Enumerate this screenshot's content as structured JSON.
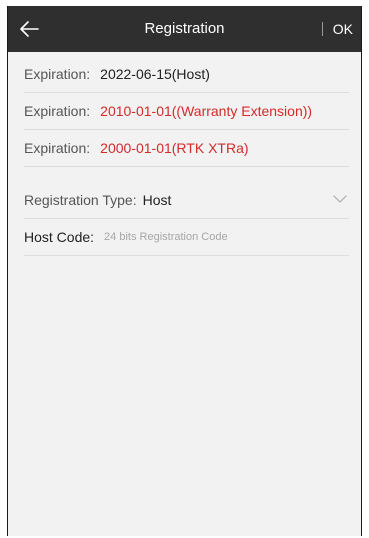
{
  "header": {
    "title": "Registration",
    "ok_label": "OK"
  },
  "expirations": [
    {
      "label": "Expiration:",
      "value": "2022-06-15(Host)",
      "color": "#222222"
    },
    {
      "label": "Expiration:",
      "value": "2010-01-01((Warranty Extension))",
      "color": "#d42a2a"
    },
    {
      "label": "Expiration:",
      "value": "2000-01-01(RTK XTRa)",
      "color": "#d42a2a"
    }
  ],
  "registration_type": {
    "label": "Registration Type:",
    "value": "Host"
  },
  "host_code": {
    "label": "Host Code:",
    "placeholder": "24 bits Registration Code"
  },
  "icons": {
    "back": "back-arrow-icon",
    "dropdown": "chevron-down-icon"
  },
  "colors": {
    "titlebar": "#2f2f2f",
    "background": "#f2f2f2",
    "warning_text": "#d42a2a"
  }
}
